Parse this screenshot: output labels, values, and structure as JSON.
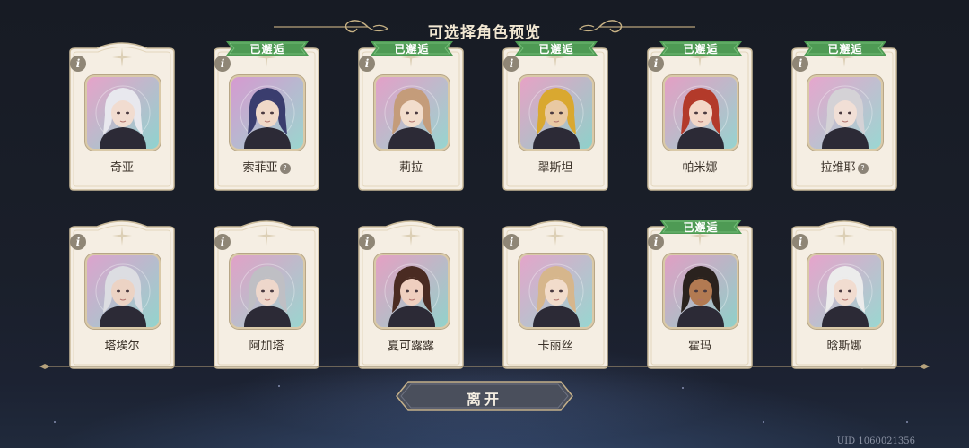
{
  "title": "可选择角色预览",
  "met_label": "已邂逅",
  "info_glyph": "i",
  "rebadge_glyph": "?",
  "leave_label": "离开",
  "uid": "UID 1060021356",
  "characters": [
    {
      "name": "奇亚",
      "met": false,
      "badge": false,
      "hair": "#e8e8ee",
      "skin": "#f1dcd0",
      "bg1": "#e6a3c9",
      "bg2": "#8fd3cf"
    },
    {
      "name": "索菲亚",
      "met": true,
      "badge": true,
      "hair": "#3a3d6e",
      "skin": "#f0d9c8",
      "bg1": "#d69ad0",
      "bg2": "#9ad6cf"
    },
    {
      "name": "莉拉",
      "met": true,
      "badge": false,
      "hair": "#c49c7a",
      "skin": "#f2ddcc",
      "bg1": "#e3a0c8",
      "bg2": "#97d5cf"
    },
    {
      "name": "翠斯坦",
      "met": true,
      "badge": false,
      "hair": "#d9a830",
      "skin": "#e9c9a3",
      "bg1": "#e7a2c5",
      "bg2": "#8ed1ca"
    },
    {
      "name": "帕米娜",
      "met": true,
      "badge": false,
      "hair": "#b33a2a",
      "skin": "#f3d7c7",
      "bg1": "#e49fc4",
      "bg2": "#96d3cf"
    },
    {
      "name": "拉维耶",
      "met": true,
      "badge": true,
      "hair": "#d4d2d6",
      "skin": "#f1dfd6",
      "bg1": "#e6a6cd",
      "bg2": "#9ad7d2"
    },
    {
      "name": "塔埃尔",
      "met": false,
      "badge": false,
      "hair": "#dcdde2",
      "skin": "#ecd3c4",
      "bg1": "#dca3cd",
      "bg2": "#93d4cd"
    },
    {
      "name": "阿加塔",
      "met": false,
      "badge": false,
      "hair": "#bfbfc4",
      "skin": "#eed7cb",
      "bg1": "#e1a1c7",
      "bg2": "#9ad5cf"
    },
    {
      "name": "夏可露露",
      "met": false,
      "badge": false,
      "hair": "#4a2b22",
      "skin": "#efcfbf",
      "bg1": "#e5a0c3",
      "bg2": "#92d2cb"
    },
    {
      "name": "卡丽丝",
      "met": false,
      "badge": false,
      "hair": "#d6b68c",
      "skin": "#f2dccb",
      "bg1": "#e4a5ca",
      "bg2": "#98d6d0"
    },
    {
      "name": "霍玛",
      "met": true,
      "badge": false,
      "hair": "#2a221e",
      "skin": "#b27a52",
      "bg1": "#e09fc4",
      "bg2": "#8fd0c9"
    },
    {
      "name": "晗斯娜",
      "met": false,
      "badge": false,
      "hair": "#ececec",
      "skin": "#f1dcd0",
      "bg1": "#e6a4cb",
      "bg2": "#9ad7d1"
    }
  ]
}
